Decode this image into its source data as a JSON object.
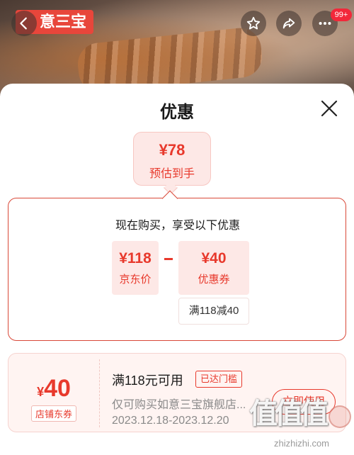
{
  "hero": {
    "shop_badge": "意三宝",
    "message_count": "99+"
  },
  "sheet": {
    "title": "优惠",
    "estimate": {
      "price": "¥78",
      "label": "预估到手"
    },
    "breakdown": {
      "title": "现在购买，享受以下优惠",
      "jd_price": {
        "price": "¥118",
        "label": "京东价"
      },
      "operator": "-",
      "coupon": {
        "price": "¥40",
        "label": "优惠券",
        "condition": "满118减40"
      }
    },
    "coupon_card": {
      "currency": "¥",
      "amount": "40",
      "type": "店铺东券",
      "condition": "满118元可用",
      "status": "已达门槛",
      "scope": "仅可购买如意三宝旗舰店...",
      "dates": "2023.12.18-2023.12.20",
      "action": "立即使用"
    }
  },
  "watermark": {
    "url": "zhizhizhi.com"
  },
  "colors": {
    "accent": "#e8392c",
    "accent_bg": "#fde8e6",
    "coupon_bg": "#fff4f2"
  }
}
